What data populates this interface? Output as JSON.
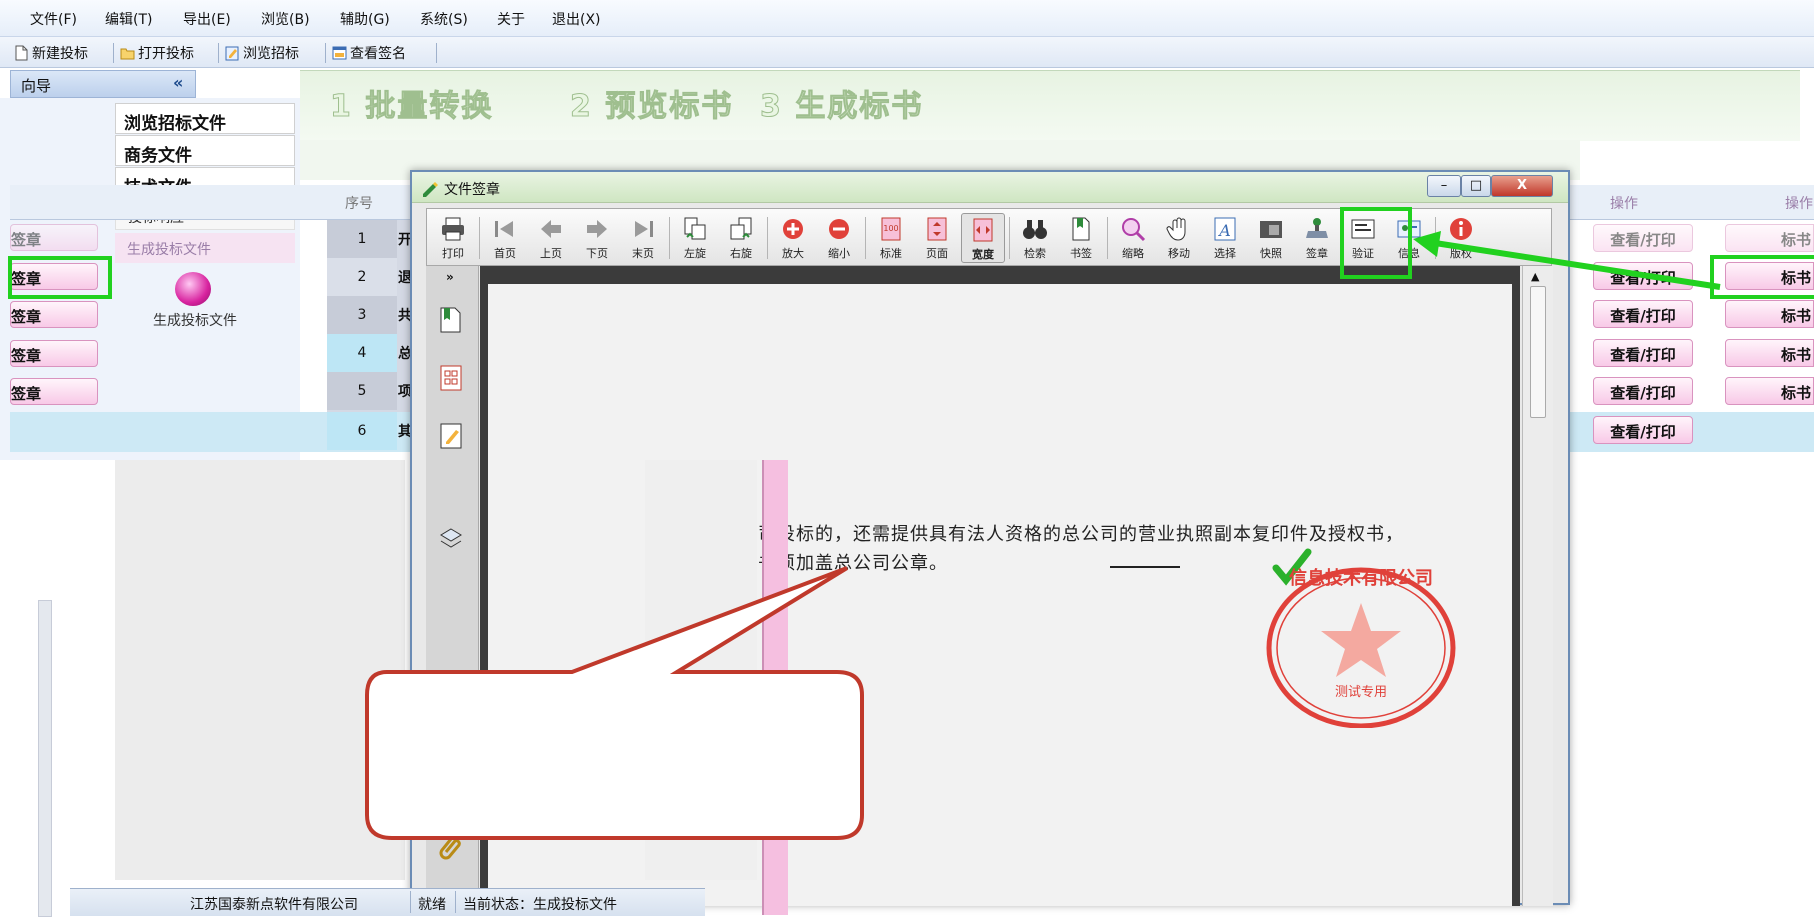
{
  "menu": {
    "items": [
      "文件(F)",
      "编辑(T)",
      "导出(E)",
      "浏览(B)",
      "辅助(G)",
      "系统(S)",
      "关于",
      "退出(X)"
    ]
  },
  "toolbar": {
    "new_bid": "新建投标",
    "open_bid": "打开投标",
    "browse_tender": "浏览招标",
    "view_sign": "查看签名"
  },
  "nav": {
    "header": "向导",
    "collapse": "«",
    "items": [
      "浏览招标文件",
      "商务文件",
      "技术文件"
    ],
    "sub1": "投标响应",
    "sub2": "生成投标文件",
    "gen_label": "生成投标文件"
  },
  "steps": [
    "1 批量转换",
    "2 预览标书",
    "3 生成标书"
  ],
  "grid": {
    "col_seq": "序号",
    "col_view": "操作",
    "col_right": "操作",
    "rows": [
      {
        "no": "1",
        "t": "开",
        "left": "签章",
        "view": "查看/打印",
        "right": "标书"
      },
      {
        "no": "2",
        "t": "退",
        "left": "签章",
        "view": "查看/打印",
        "right": "标书"
      },
      {
        "no": "3",
        "t": "共",
        "left": "签章",
        "view": "查看/打印",
        "right": "标书"
      },
      {
        "no": "4",
        "t": "总",
        "left": "签章",
        "view": "查看/打印",
        "right": "标书"
      },
      {
        "no": "5",
        "t": "项",
        "left": "签章",
        "view": "查看/打印",
        "right": "标书"
      },
      {
        "no": "6",
        "t": "其",
        "left": "",
        "view": "查看/打印",
        "right": ""
      }
    ]
  },
  "window": {
    "title": "文件签章",
    "min": "–",
    "max": "□",
    "close": "X"
  },
  "doc_toolbar": {
    "print": "打印",
    "first": "首页",
    "prev": "上页",
    "next": "下页",
    "last": "末页",
    "rotate_l": "左旋",
    "rotate_r": "右旋",
    "zoom_in": "放大",
    "zoom_out": "缩小",
    "standard": "标准",
    "page": "页面",
    "width": "宽度",
    "find": "检索",
    "note": "书签",
    "magnify": "缩略",
    "hand": "移动",
    "select": "选择",
    "snap": "快照",
    "sign": "签章",
    "verify": "验证",
    "info": "信息",
    "about": "版权"
  },
  "document": {
    "line1": "分公司投标的，还需提供具有法人资格的总公司的营业执照副本复印件及授权书，",
    "line2": "授权书须加盖总公司公章。"
  },
  "stamp": {
    "org": "信息技术有限公司",
    "sub": "测试专用",
    "mark": "★"
  },
  "status": {
    "company": "江苏国泰新点软件有限公司",
    "ready": "就绪",
    "state": "当前状态：生成投标文件"
  },
  "colors": {
    "highlight": "#21d11f",
    "pink_button": "#f8c9e7",
    "stamp_red": "#e0413a",
    "bubble_stroke": "#c0392b"
  }
}
